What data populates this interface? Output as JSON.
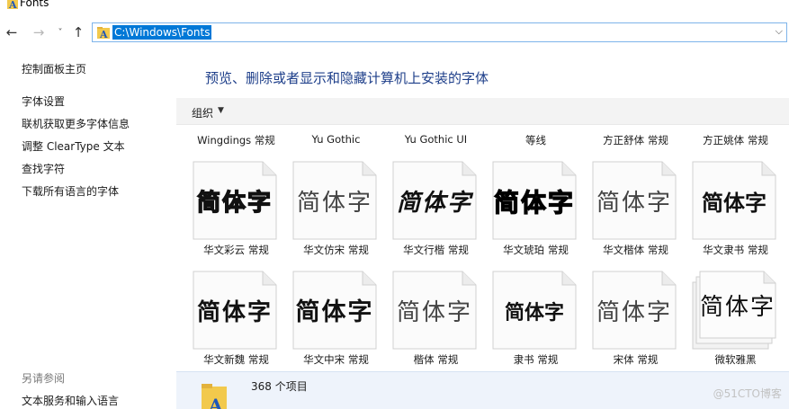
{
  "window": {
    "title": "Fonts"
  },
  "nav": {
    "back_icon": "arrow-left-icon",
    "forward_icon": "arrow-right-icon",
    "recent_icon": "chevron-down-icon",
    "up_icon": "arrow-up-icon",
    "address": "C:\\Windows\\Fonts"
  },
  "sidebar": {
    "home": "控制面板主页",
    "links": [
      {
        "label": "字体设置"
      },
      {
        "label": "联机获取更多字体信息"
      },
      {
        "label": "调整 ClearType 文本"
      },
      {
        "label": "查找字符"
      },
      {
        "label": "下载所有语言的字体"
      }
    ],
    "see_also_heading": "另请参阅",
    "see_also_link": "文本服务和输入语言"
  },
  "main": {
    "title": "预览、删除或者显示和隐藏计算机上安装的字体",
    "organize": "组织"
  },
  "fonts": {
    "top_labels": [
      "Wingdings 常规",
      "Yu Gothic",
      "Yu Gothic UI",
      "等线",
      "方正舒体 常规",
      "方正姚体 常规"
    ],
    "row1": [
      {
        "name": "华文彩云 常规",
        "preview": "简体字"
      },
      {
        "name": "华文仿宋 常规",
        "preview": "简体字"
      },
      {
        "name": "华文行楷 常规",
        "preview": "简体字"
      },
      {
        "name": "华文琥珀 常规",
        "preview": "简体字"
      },
      {
        "name": "华文楷体 常规",
        "preview": "简体字"
      },
      {
        "name": "华文隶书 常规",
        "preview": "简体字"
      }
    ],
    "row2": [
      {
        "name": "华文新魏 常规",
        "preview": "简体字"
      },
      {
        "name": "华文中宋 常规",
        "preview": "简体字"
      },
      {
        "name": "楷体 常规",
        "preview": "简体字"
      },
      {
        "name": "隶书 常规",
        "preview": "简体字"
      },
      {
        "name": "宋体 常规",
        "preview": "简体字"
      },
      {
        "name": "微软雅黑",
        "preview": "简体字"
      }
    ]
  },
  "details": {
    "count": "368 个项目"
  },
  "watermark": "@51CTO博客"
}
